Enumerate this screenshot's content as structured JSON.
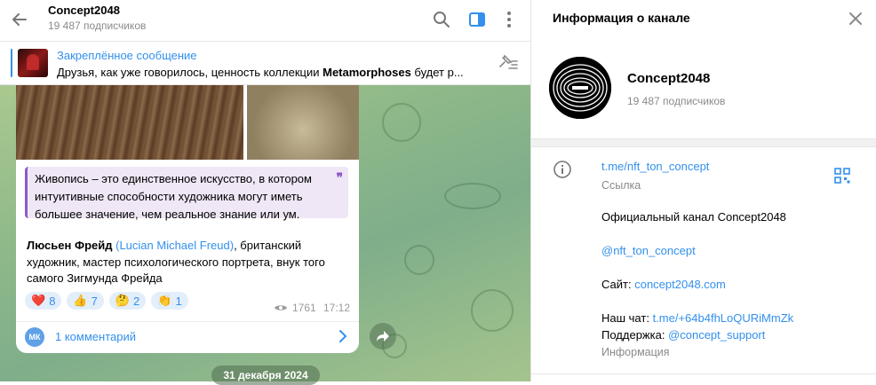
{
  "header": {
    "title": "Concept2048",
    "subscribers": "19 487 подписчиков"
  },
  "pinned": {
    "title": "Закреплённое сообщение",
    "text_before": "Друзья, как уже говорилось, ценность коллекции ",
    "text_bold": "Metamorphoses",
    "text_after": " будет р..."
  },
  "post": {
    "quote_lines": [
      "Живопись – это единственное искусство, в котором",
      "интуитивные способности художника могут иметь",
      "большее значение, чем реальное знание или ум."
    ],
    "author_name": "Люсьен Фрейд",
    "author_link": "(Lucian Michael Freud)",
    "text_line1_rest": ", британский",
    "text_line2": "художник, мастер психологического портрета, внук того",
    "text_line3": "самого Зигмунда Фрейда",
    "reactions": [
      {
        "emoji": "❤️",
        "count": "8"
      },
      {
        "emoji": "👍",
        "count": "7"
      },
      {
        "emoji": "🤔",
        "count": "2"
      },
      {
        "emoji": "👏",
        "count": "1"
      }
    ],
    "views": "1761",
    "time": "17:12",
    "comment_avatar": "МК",
    "comments_label": "1 комментарий"
  },
  "date_pill": "31 декабря 2024",
  "panel": {
    "title": "Информация о канале",
    "name": "Concept2048",
    "subscribers": "19 487 подписчиков",
    "link": "t.me/nft_ton_concept",
    "link_caption": "Ссылка",
    "desc_line1": "Официальный канал Concept2048",
    "desc_handle": "@nft_ton_concept",
    "site_label": "Сайт: ",
    "site_link": "concept2048.com",
    "chat_label": "Наш чат: ",
    "chat_link": "t.me/+64b4fhLoQURiMmZk",
    "support_label": "Поддержка: ",
    "support_link": "@concept_support",
    "info_caption": "Информация"
  },
  "colors": {
    "accent": "#3390ec",
    "quote_accent": "#8e5ac8"
  }
}
